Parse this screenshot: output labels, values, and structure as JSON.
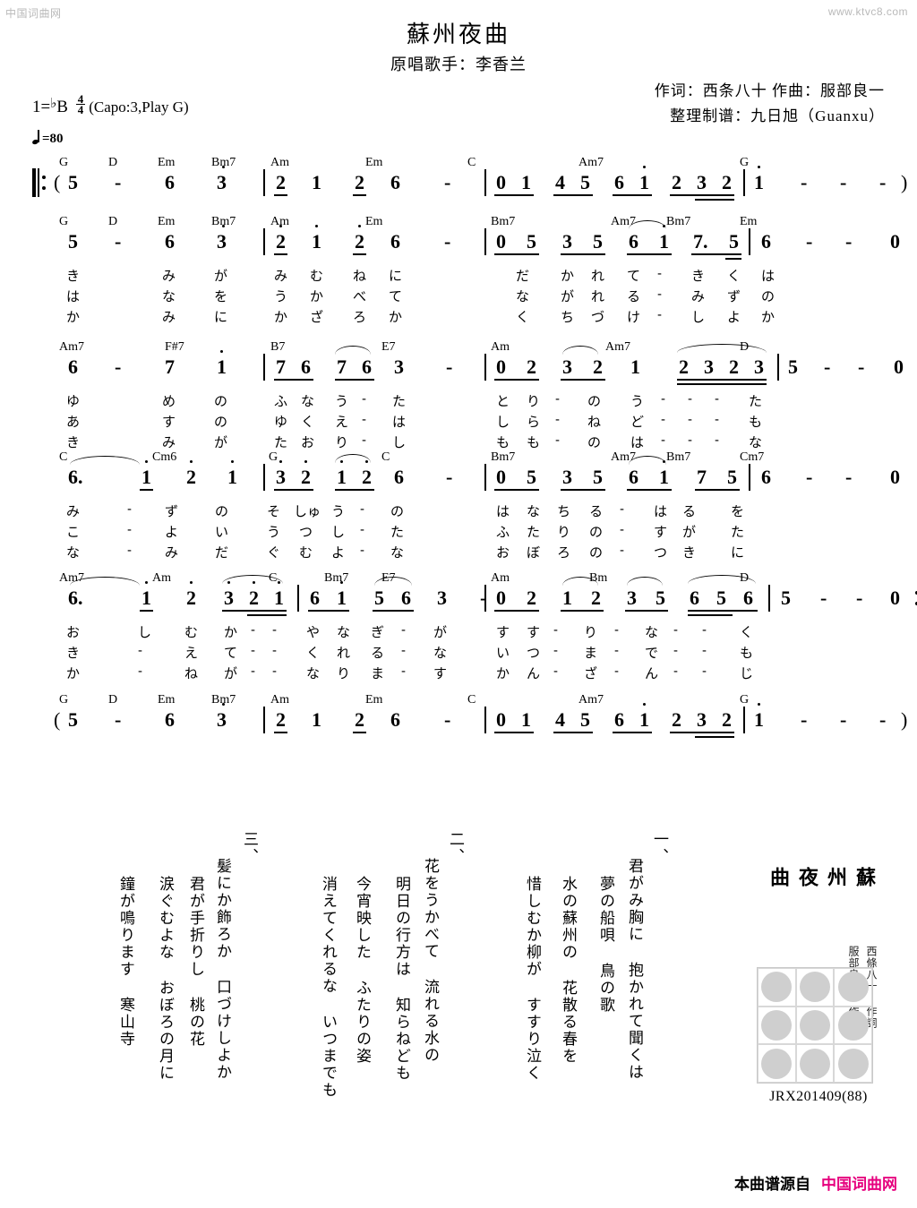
{
  "watermarks": {
    "left": "中国词曲网",
    "right": "www.ktvc8.com"
  },
  "header": {
    "title": "蘇州夜曲",
    "subtitle": "原唱歌手：李香兰",
    "credit_line1": "作词：西条八十  作曲：服部良一",
    "credit_line2": "整理制谱：九日旭（Guanxu）"
  },
  "key_info": {
    "key_prefix": "1=",
    "flat": "♭",
    "key_letter": "B",
    "meter_num": "4",
    "meter_den": "4",
    "capo": "(Capo:3,Play G)",
    "tempo": "=80"
  },
  "lines": [
    {
      "id": "line-1",
      "chords": [
        "G",
        "D",
        "Em",
        "Bm7",
        "Am",
        "Em",
        "C",
        "Am7",
        "G"
      ],
      "notes": [
        "(",
        "5",
        "-",
        "6",
        "3",
        "2",
        "1",
        "2",
        "6",
        "-",
        "0",
        "1",
        "4",
        "5",
        "6",
        "1",
        "2",
        "3",
        "2",
        "1",
        "-",
        "-",
        "-",
        ")"
      ],
      "lyrics": []
    },
    {
      "id": "line-2",
      "chords": [
        "G",
        "D",
        "Em",
        "Bm7",
        "Am",
        "Em",
        "Bm7",
        "Am7",
        "Bm7",
        "Em"
      ],
      "notes": [
        "5",
        "-",
        "6",
        "3",
        "2",
        "1",
        "2",
        "6",
        "-",
        "0",
        "5",
        "3",
        "5",
        "6",
        "1",
        "7.",
        "5",
        "6",
        "-",
        "-",
        "0"
      ],
      "lyrics": [
        [
          "き",
          "み",
          "が",
          "み",
          "む",
          "ね",
          "に",
          "だ",
          "か",
          "れ",
          "て",
          "-",
          "き",
          "く",
          "は"
        ],
        [
          "は",
          "な",
          "を",
          "う",
          "か",
          "べ",
          "て",
          "な",
          "が",
          "れ",
          "る",
          "-",
          "み",
          "ず",
          "の"
        ],
        [
          "か",
          "み",
          "に",
          "か",
          "ざ",
          "ろ",
          "か",
          "く",
          "ち",
          "づ",
          "け",
          "-",
          "し",
          "よ",
          "か"
        ]
      ]
    },
    {
      "id": "line-3",
      "chords": [
        "Am7",
        "F#7",
        "B7",
        "E7",
        "Am",
        "Am7",
        "D"
      ],
      "notes": [
        "6",
        "-",
        "7",
        "1",
        "7",
        "6",
        "7",
        "6",
        "3",
        "-",
        "0",
        "2",
        "3",
        "2",
        "1",
        "2",
        "3",
        "2",
        "3",
        "5",
        "-",
        "-",
        "0"
      ],
      "lyrics": [
        [
          "ゆ",
          "め",
          "の",
          "ふ",
          "な",
          "う",
          "-",
          "た",
          "と",
          "り",
          "-",
          "の",
          "う",
          "-",
          "-",
          "-",
          "た"
        ],
        [
          "あ",
          "す",
          "の",
          "ゆ",
          "く",
          "え",
          "-",
          "は",
          "し",
          "ら",
          "-",
          "ね",
          "ど",
          "-",
          "-",
          "-",
          "も"
        ],
        [
          "き",
          "み",
          "が",
          "た",
          "お",
          "り",
          "-",
          "し",
          "も",
          "も",
          "-",
          "の",
          "は",
          "-",
          "-",
          "-",
          "な"
        ]
      ]
    },
    {
      "id": "line-4",
      "chords": [
        "C",
        "Cm6",
        "G",
        "C",
        "Bm7",
        "Am7",
        "Bm7",
        "Cm7"
      ],
      "notes": [
        "6.",
        "1",
        "2",
        "1",
        "3",
        "2",
        "1",
        "2",
        "6",
        "-",
        "0",
        "5",
        "3",
        "5",
        "6",
        "1",
        "7",
        "5",
        "6",
        "-",
        "-",
        "0"
      ],
      "lyrics": [
        [
          "み",
          "-",
          "ず",
          "の",
          "そ",
          "しゅ",
          "う",
          "-",
          "の",
          "は",
          "な",
          "ち",
          "る",
          "-",
          "は",
          "る",
          "を"
        ],
        [
          "こ",
          "-",
          "よ",
          "い",
          "う",
          "つ",
          "し",
          "-",
          "た",
          "ふ",
          "た",
          "り",
          "の",
          "-",
          "す",
          "が",
          "た"
        ],
        [
          "な",
          "-",
          "み",
          "だ",
          "ぐ",
          "む",
          "よ",
          "-",
          "な",
          "お",
          "ぼ",
          "ろ",
          "の",
          "-",
          "つ",
          "き",
          "に"
        ]
      ]
    },
    {
      "id": "line-5",
      "chords": [
        "Am7",
        "Am",
        "C",
        "Bm7",
        "E7",
        "Am",
        "Bm",
        "D"
      ],
      "notes": [
        "6.",
        "1",
        "2",
        "3",
        "2",
        "1",
        "6",
        "1",
        "5",
        "6",
        "3",
        "-",
        "0",
        "2",
        "1",
        "2",
        "3",
        "5",
        "6",
        "5",
        "6",
        "5",
        "-",
        "-",
        "0"
      ],
      "lyrics": [
        [
          "お",
          "し",
          "む",
          "か",
          "-",
          "-",
          "や",
          "な",
          "ぎ",
          "-",
          "が",
          "す",
          "す",
          "-",
          "り",
          "-",
          "な",
          "-",
          "-",
          "く"
        ],
        [
          "き",
          "-",
          "え",
          "て",
          "-",
          "-",
          "く",
          "れ",
          "る",
          "-",
          "な",
          "い",
          "つ",
          "-",
          "ま",
          "-",
          "で",
          "-",
          "-",
          "も"
        ],
        [
          "か",
          "-",
          "ね",
          "が",
          "-",
          "-",
          "な",
          "り",
          "ま",
          "-",
          "す",
          "か",
          "ん",
          "-",
          "ざ",
          "-",
          "ん",
          "-",
          "-",
          "じ"
        ]
      ]
    },
    {
      "id": "line-6",
      "chords": [
        "G",
        "D",
        "Em",
        "Bm7",
        "Am",
        "Em",
        "C",
        "Am7",
        "G"
      ],
      "notes": [
        "(",
        "5",
        "-",
        "6",
        "3",
        "2",
        "1",
        "2",
        "6",
        "-",
        "0",
        "1",
        "4",
        "5",
        "6",
        "1",
        "2",
        "3",
        "2",
        "1",
        "-",
        "-",
        "-",
        ")"
      ],
      "lyrics": []
    }
  ],
  "verses": [
    {
      "number": "一、",
      "columns": [
        "君がみ胸に  抱かれて聞くは",
        "夢の船唄  鳥の歌",
        "水の蘇州の  花散る春を",
        "惜しむか柳が  すすり泣く"
      ]
    },
    {
      "number": "二、",
      "columns": [
        "花をうかべて  流れる水の",
        "明日の行方は  知らねども",
        "今宵映した  ふたりの姿",
        "消えてくれるな  いつまでも"
      ]
    },
    {
      "number": "三、",
      "columns": [
        "髪にか飾ろか  口づけしよか",
        "君が手折りし  桃の花",
        "涙ぐむよな  おぼろの月に",
        "鐘が鳴ります  寒山寺"
      ]
    }
  ],
  "seal": {
    "title": "蘇州夜曲",
    "lyricist": "西條八十 作詞",
    "composer": "服部良一 作曲",
    "code": "JRX201409(88)"
  },
  "footer": {
    "text": "本曲谱源自",
    "source": "中国词曲网",
    "source_color": "#e6007e"
  }
}
